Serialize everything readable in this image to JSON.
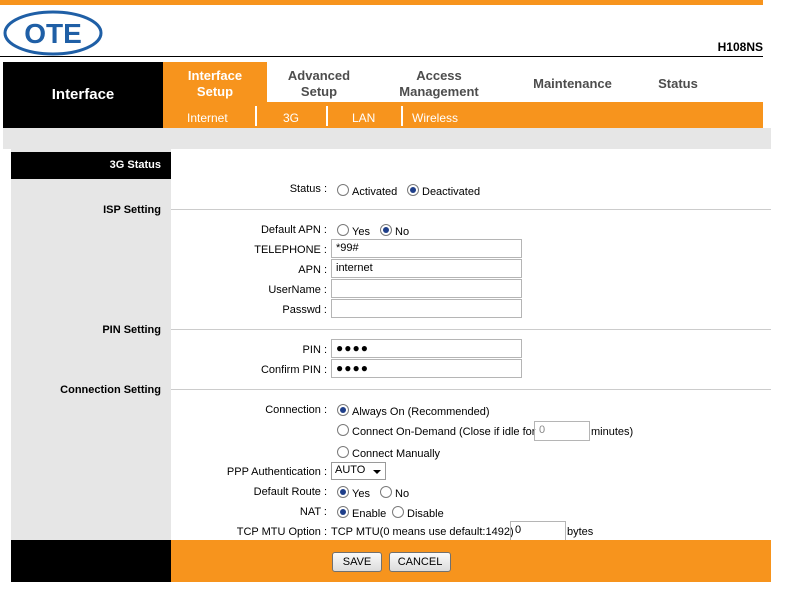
{
  "header": {
    "logo_text": "OTE",
    "model": "H108NS"
  },
  "nav": {
    "section_title": "Interface",
    "tabs": [
      {
        "line1": "Interface",
        "line2": "Setup"
      },
      {
        "line1": "Advanced",
        "line2": "Setup"
      },
      {
        "line1": "Access",
        "line2": "Management"
      },
      {
        "line1": "Maintenance",
        "line2": ""
      },
      {
        "line1": "Status",
        "line2": ""
      }
    ],
    "subtabs": [
      "Internet",
      "3G",
      "LAN",
      "Wireless"
    ]
  },
  "status_section": {
    "header": "3G Status",
    "status_label": "Status :",
    "opt_activated": "Activated",
    "opt_deactivated": "Deactivated",
    "selected": "Deactivated"
  },
  "isp": {
    "title": "ISP Setting",
    "default_apn_label": "Default APN :",
    "yes": "Yes",
    "no": "No",
    "telephone_label": "TELEPHONE :",
    "telephone_value": "*99#",
    "apn_label": "APN :",
    "apn_value": "internet",
    "username_label": "UserName :",
    "username_value": "",
    "passwd_label": "Passwd :",
    "passwd_value": ""
  },
  "pin": {
    "title": "PIN Setting",
    "pin_label": "PIN :",
    "pin_value": "●●●●",
    "confirm_label": "Confirm PIN :",
    "confirm_value": "●●●●"
  },
  "connection": {
    "title": "Connection Setting",
    "connection_label": "Connection :",
    "opt_always": "Always On (Recommended)",
    "opt_demand": "Connect On-Demand (Close if idle for",
    "idle_value": "0",
    "minutes": "minutes)",
    "opt_manual": "Connect Manually",
    "ppp_label": "PPP Authentication :",
    "ppp_value": "AUTO",
    "default_route_label": "Default Route :",
    "yes": "Yes",
    "no": "No",
    "nat_label": "NAT :",
    "enable": "Enable",
    "disable": "Disable",
    "mtu_label": "TCP MTU Option :",
    "mtu_text": "TCP MTU(0 means use default:1492)",
    "mtu_value": "0",
    "bytes": "bytes"
  },
  "buttons": {
    "save": "SAVE",
    "cancel": "CANCEL"
  },
  "colors": {
    "accent": "#f7941d",
    "logo_blue": "#1f5fa6",
    "header_black": "#000000"
  }
}
